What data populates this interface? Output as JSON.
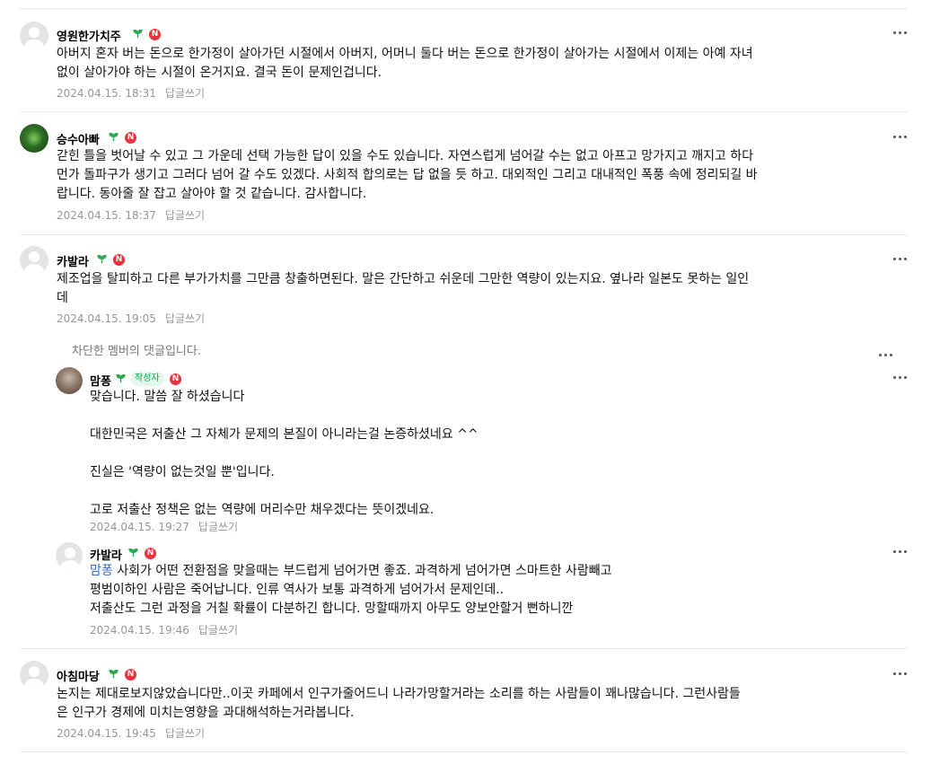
{
  "icons": {
    "more": "more-dots-icon",
    "sprout": "sprout-icon",
    "newbie": "n-badge-icon"
  },
  "colors": {
    "n_badge": "#e8323c",
    "author_badge": "#03a94d",
    "mention": "#3a6bbf",
    "meta": "#979797"
  },
  "reply_label": "답글쓰기",
  "comments": [
    {
      "nickname": "영원한가치주",
      "n_badge": "N",
      "text": "아버지 혼자 버는 돈으로 한가정이 살아가던 시절에서 아버지, 어머니 둘다 버는 돈으로 한가정이 살아가는 시절에서 이제는 아예 자녀\n없이 살아가야 하는 시절이 온거지요. 결국 돈이 문제인겁니다.",
      "date": "2024.04.15. 18:31"
    },
    {
      "nickname": "승수아빠",
      "n_badge": "N",
      "text": "갇힌 틀을 벗어날 수 있고 그 가운데 선택 가능한 답이 있을 수도 있습니다. 자연스럽게 넘어갈 수는 없고 아프고 망가지고 깨지고 하다\n먼가 돌파구가 생기고 그러다 넘어 갈 수도 있겠다. 사회적 합의로는 답 없을 듯 하고. 대외적인 그리고 대내적인 폭풍 속에 정리되길 바\n랍니다. 동아줄 잘 잡고 살아야 할 것 같습니다. 감사합니다.",
      "date": "2024.04.15. 18:37"
    },
    {
      "nickname": "카발라",
      "n_badge": "N",
      "text": "제조업을 탈피하고 다른 부가가치를 그만큼 창출하면된다. 말은 간단하고 쉬운데 그만한 역량이 있는지요. 옆나라 일본도 못하는 일인\n데",
      "date": "2024.04.15. 19:05"
    },
    {
      "blocked_text": "차단한 멤버의 댓글입니다."
    },
    {
      "nickname": "맘퐁",
      "author_badge": "작성자",
      "n_badge": "N",
      "text": "맞습니다. 말씀 잘 하셨습니다\n\n대한민국은 저출산 그 자체가 문제의 본질이 아니라는걸 논증하셨네요 ^^\n\n진실은 '역량이 없는것일 뿐'입니다.\n\n고로 저출산 정책은 없는 역량에 머리수만 채우겠다는 뜻이겠네요.",
      "date": "2024.04.15. 19:27"
    },
    {
      "nickname": "카발라",
      "n_badge": "N",
      "mention": "맘퐁",
      "text": " 사회가 어떤 전환점을 맞을때는 부드럽게 넘어가면 좋죠. 과격하게 넘어가면 스마트한 사람빼고\n평범이하인 사람은 죽어납니다. 인류 역사가 보통 과격하게 넘어가서 문제인데..\n저출산도 그런 과정을 거칠 확률이 다분하긴 합니다. 망할때까지 아무도 양보안할거 뻔하니깐",
      "date": "2024.04.15. 19:46"
    },
    {
      "nickname": "아침마당",
      "n_badge": "N",
      "text": "논지는 제대로보지않았습니다만..이곳 카페에서 인구가줄어드니 나라가망할거라는 소리를 하는 사람들이 꽤나많습니다. 그런사람들\n은 인구가 경제에 미치는영향을 과대해석하는거라봅니다.",
      "date": "2024.04.15. 19:45"
    }
  ]
}
